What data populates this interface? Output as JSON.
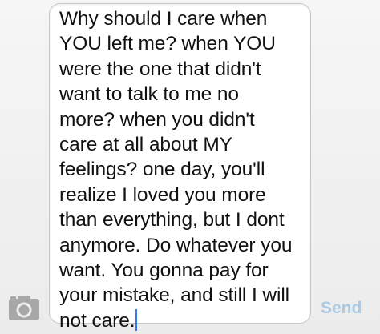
{
  "message": {
    "lines": [
      "Why should I care when",
      "YOU left me? when YOU",
      "were the one that didn't",
      "want to talk to me no",
      "more? when you didn't",
      "care at all about MY",
      "feelings? one day, you'll",
      "realize I loved you more",
      "than everything, but I dont",
      "anymore. Do whatever you",
      "want. You gonna pay for",
      "your mistake, and still I will",
      "not care."
    ]
  },
  "toolbar": {
    "camera_icon": "camera-icon",
    "send_label": "Send"
  },
  "colors": {
    "send_disabled": "#a9c9e4",
    "caret": "#3478f6",
    "camera": "#a7a7a7"
  }
}
